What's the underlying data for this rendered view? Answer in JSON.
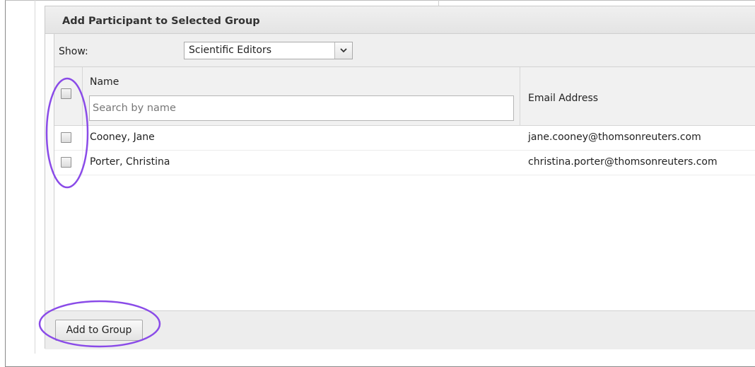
{
  "panel": {
    "title": "Add Participant to Selected Group"
  },
  "toolbar": {
    "show_label": "Show:",
    "role_select": {
      "value": "Scientific Editors"
    }
  },
  "table": {
    "columns": {
      "name": "Name",
      "email": "Email Address"
    },
    "search_placeholder": "Search by name",
    "rows": [
      {
        "name": "Cooney, Jane",
        "email": "jane.cooney@thomsonreuters.com"
      },
      {
        "name": "Porter, Christina",
        "email": "christina.porter@thomsonreuters.com"
      }
    ]
  },
  "footer": {
    "add_button_label": "Add to Group"
  },
  "colors": {
    "annotation_highlight": "#8a4be8"
  },
  "icons": [
    "chevron-down-icon"
  ]
}
